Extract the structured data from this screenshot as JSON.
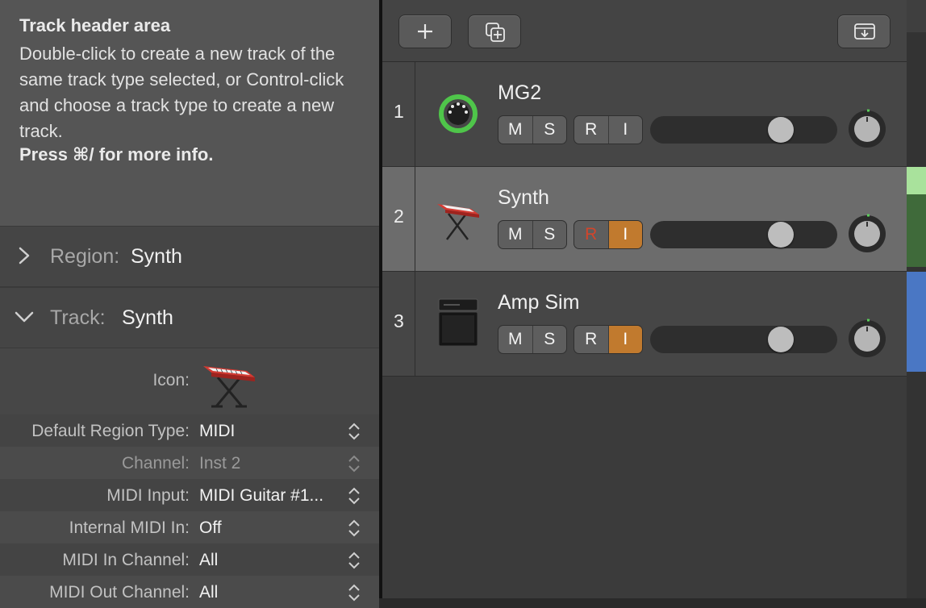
{
  "help": {
    "title": "Track header area",
    "body": "Double-click to create a new track of the same track type selected, or Control-click and choose a track type to create a new track.",
    "more": "Press ⌘/ for more info."
  },
  "region_section": {
    "label": "Region:",
    "value": "Synth",
    "expanded": false
  },
  "track_section": {
    "label": "Track:",
    "value": "Synth",
    "expanded": true
  },
  "params": {
    "icon_label": "Icon:",
    "rows": [
      {
        "label": "Default Region Type:",
        "value": "MIDI"
      },
      {
        "label": "Channel:",
        "value": "Inst 2"
      },
      {
        "label": "MIDI Input:",
        "value": "MIDI Guitar #1..."
      },
      {
        "label": "Internal MIDI In:",
        "value": "Off"
      },
      {
        "label": "MIDI In Channel:",
        "value": "All"
      },
      {
        "label": "MIDI Out Channel:",
        "value": "All"
      }
    ]
  },
  "toolbar": {
    "add_icon": "plus-icon",
    "duplicate_icon": "duplicate-track-icon",
    "download_icon": "tray-download-icon"
  },
  "tracks": [
    {
      "number": "1",
      "name": "MG2",
      "icon": "midi-port-icon",
      "mute": "M",
      "solo": "S",
      "record": "R",
      "input": "I",
      "selected": false,
      "record_armed": false,
      "input_on": false
    },
    {
      "number": "2",
      "name": "Synth",
      "icon": "keyboard-synth-icon",
      "mute": "M",
      "solo": "S",
      "record": "R",
      "input": "I",
      "selected": true,
      "record_armed": true,
      "input_on": true
    },
    {
      "number": "3",
      "name": "Amp Sim",
      "icon": "guitar-amp-icon",
      "mute": "M",
      "solo": "S",
      "record": "R",
      "input": "I",
      "selected": false,
      "record_armed": false,
      "input_on": true
    }
  ],
  "colors": {
    "input_on": "#c17a2e",
    "record_armed": "#d2452b",
    "midi_green": "#4fc54a"
  }
}
